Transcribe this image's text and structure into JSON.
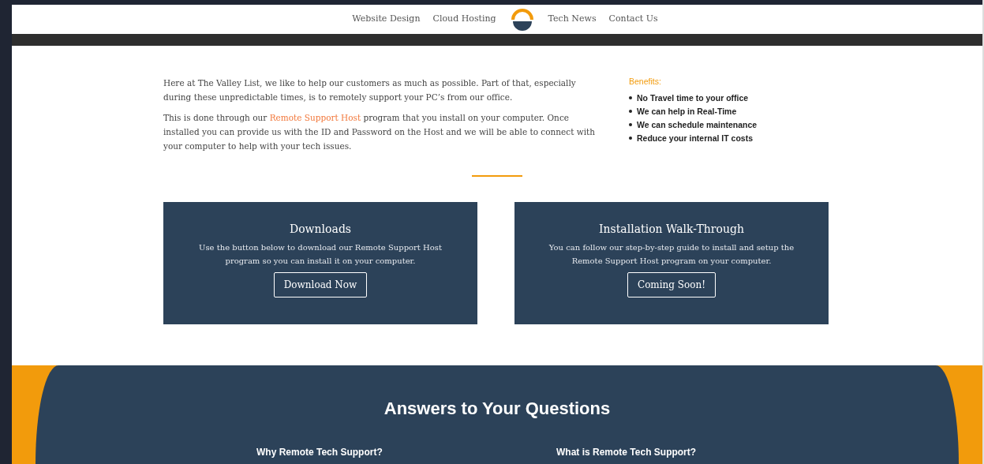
{
  "nav": {
    "items": [
      {
        "label": "Website Design"
      },
      {
        "label": "Cloud Hosting"
      },
      {
        "label": "Tech News"
      },
      {
        "label": "Contact Us"
      }
    ]
  },
  "intro": {
    "paragraphs": [
      "Here at The Valley List, we like to help our customers as much as possible. Part of that, especially during these unpredictable times, is to remotely support your PC’s from our office."
    ],
    "paragraph_2": {
      "before": "This is done through our ",
      "link": "Remote Support Host",
      "after": " program that you install on your computer. Once installed you can provide us with the ID and Password on the Host and we will be able to connect with your computer to help with your tech issues."
    }
  },
  "benefits": {
    "title": "Benefits:",
    "items": [
      "No Travel time to your office",
      "We can help in Real-Time",
      "We can schedule maintenance",
      "Reduce your internal IT costs"
    ]
  },
  "cards": [
    {
      "title": "Downloads",
      "text": "Use the button below to download our Remote Support Host program so you can install it on your computer.",
      "button": "Download Now"
    },
    {
      "title": "Installation Walk-Through",
      "text": "You can follow our step-by-step guide to install and setup the Remote Support Host program on your computer.",
      "button": "Coming Soon!"
    }
  ],
  "faq": {
    "title": "Answers to Your Questions",
    "questions": [
      "Why Remote Tech Support?",
      "What is Remote Tech Support?"
    ]
  }
}
